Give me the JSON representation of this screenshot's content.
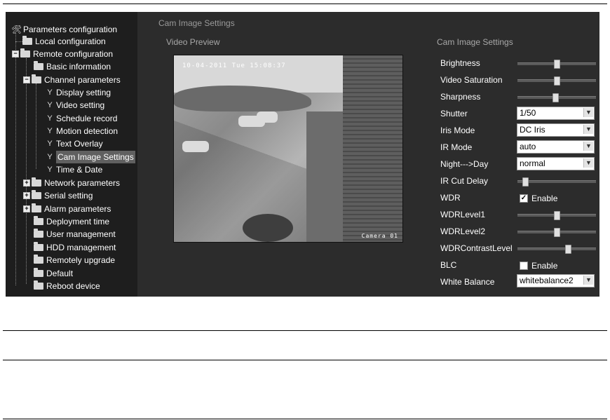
{
  "app": {
    "top_title": "Cam Image Settings",
    "video_preview_title": "Video Preview",
    "settings_title": "Cam Image Settings"
  },
  "tree": {
    "root": "Parameters configuration",
    "local": "Local configuration",
    "remote": "Remote configuration",
    "basic": "Basic information",
    "channel": "Channel parameters",
    "display": "Display setting",
    "video": "Video setting",
    "schedule": "Schedule record",
    "motion": "Motion detection",
    "overlay": "Text Overlay",
    "cam": "Cam Image Settings",
    "time": "Time & Date",
    "network": "Network parameters",
    "serial": "Serial setting",
    "alarm": "Alarm parameters",
    "deploy": "Deployment time",
    "user": "User management",
    "hdd": "HDD management",
    "upgrade": "Remotely upgrade",
    "default": "Default",
    "reboot": "Reboot device"
  },
  "preview": {
    "timestamp": "10-04-2011 Tue 15:08:37",
    "camera_label": "Camera 01"
  },
  "settings": {
    "brightness": {
      "label": "Brightness",
      "level": 0.5
    },
    "saturation": {
      "label": "Video Saturation",
      "level": 0.5
    },
    "sharpness": {
      "label": "Sharpness",
      "level": 0.48
    },
    "shutter": {
      "label": "Shutter",
      "value": "1/50"
    },
    "iris": {
      "label": "Iris Mode",
      "value": "DC Iris"
    },
    "ir_mode": {
      "label": "IR Mode",
      "value": "auto"
    },
    "night_day": {
      "label": "Night--->Day",
      "value": "normal"
    },
    "ir_cut_delay": {
      "label": "IR Cut Delay",
      "level": 0.1
    },
    "wdr": {
      "label": "WDR",
      "checked": true,
      "option": "Enable"
    },
    "wdr_level1": {
      "label": "WDRLevel1",
      "level": 0.5
    },
    "wdr_level2": {
      "label": "WDRLevel2",
      "level": 0.5
    },
    "wdr_contrast": {
      "label": "WDRContrastLevel",
      "level": 0.64
    },
    "blc": {
      "label": "BLC",
      "checked": false,
      "option": "Enable"
    },
    "white_balance": {
      "label": "White Balance",
      "value": "whitebalance2"
    }
  },
  "colors": {
    "panel_bg": "#2c2c2c",
    "sidebar_bg": "#1e1e1e",
    "text": "#ffffff",
    "muted": "#a8a8a8"
  }
}
